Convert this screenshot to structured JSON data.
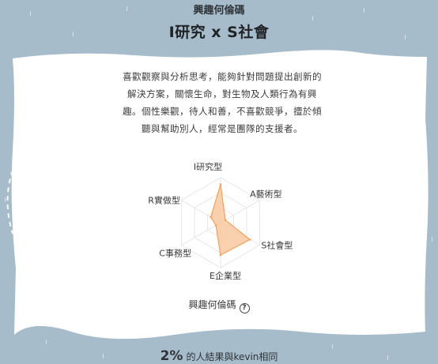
{
  "header": {
    "subtitle": "興趣何倫碼",
    "title": "I研究 x S社會"
  },
  "description": "喜歡觀察與分析思考，能夠針對問題提出創新的解決方案，關懷生命，對生物及人類行為有興趣。個性樂觀，待人和善，不喜歡競爭，擅於傾聽與幫助別人，經常是團隊的支援者。",
  "chart_data": {
    "type": "radar",
    "axes": [
      "I研究型",
      "A藝術型",
      "S社會型",
      "E企業型",
      "C事務型",
      "R實做型"
    ],
    "values": [
      0.85,
      0.12,
      0.75,
      0.72,
      0.12,
      0.25
    ],
    "range": [
      0,
      1
    ],
    "fill_color": "#f9c9a0",
    "stroke_color": "#f4a460"
  },
  "legend": {
    "label": "興趣何倫碼",
    "help_icon": "question-circle-icon"
  },
  "stat": {
    "percent": "2%",
    "text": "的人結果與kevin相同"
  }
}
